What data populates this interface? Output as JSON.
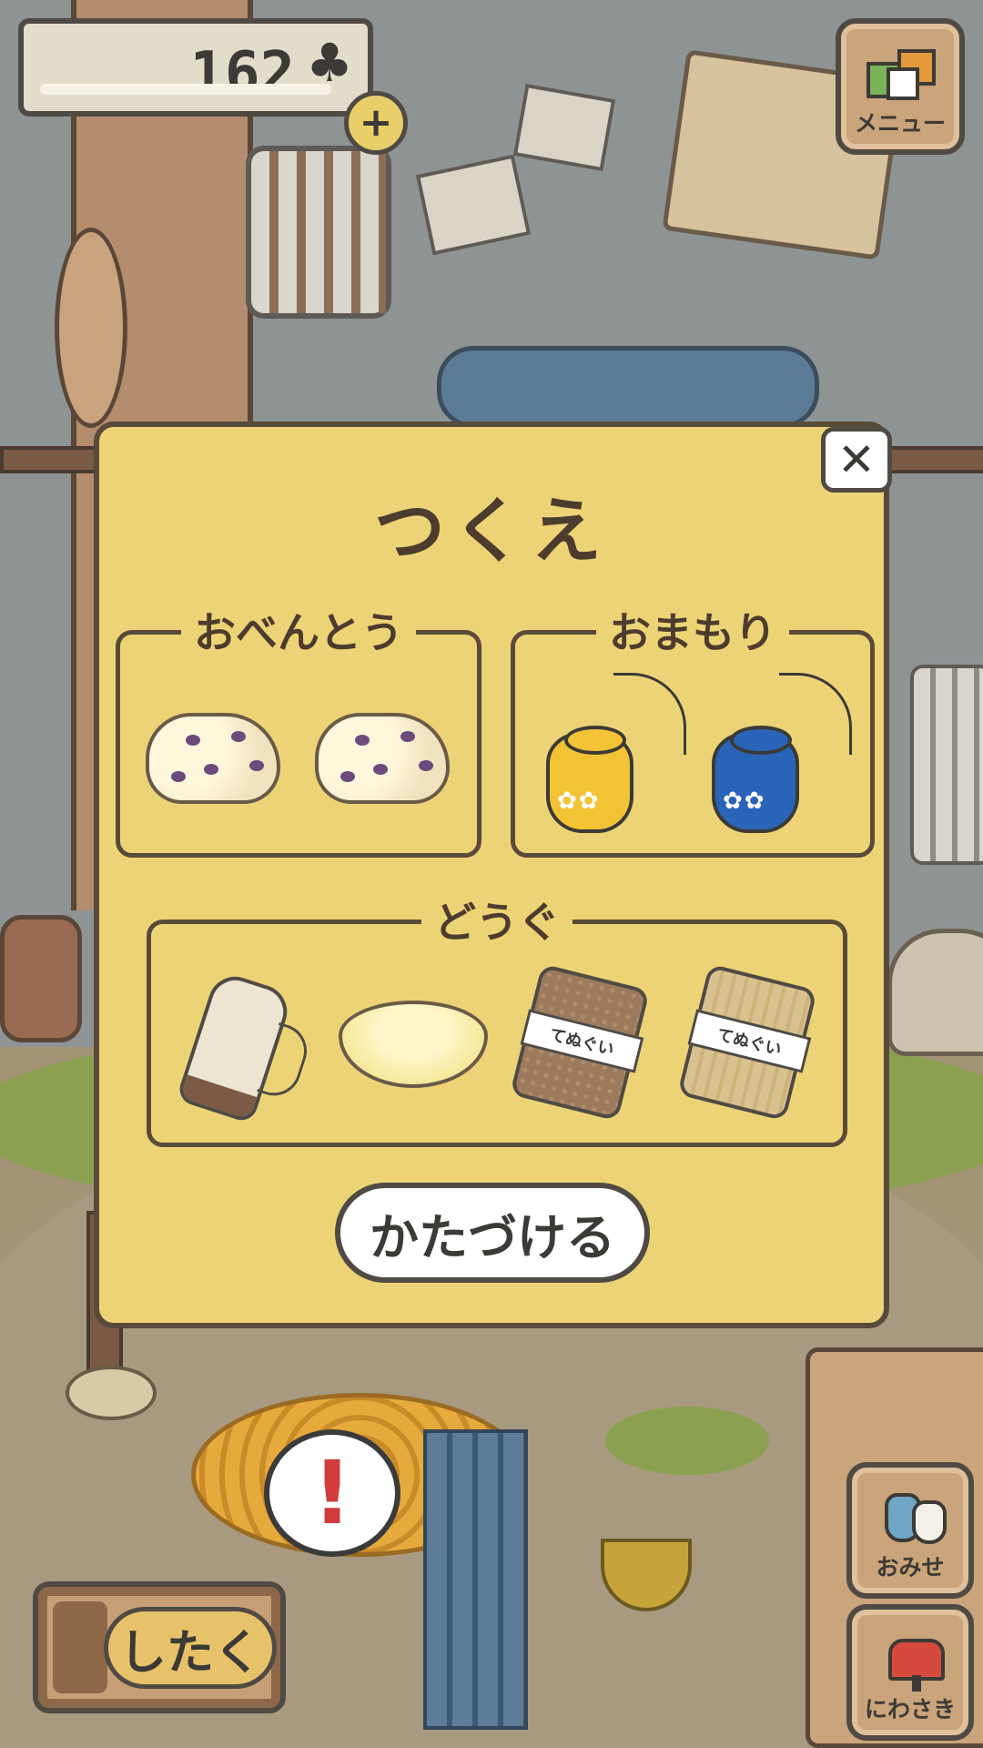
{
  "currency": {
    "value": "162",
    "icon": "clover-icon",
    "add_label": "+"
  },
  "menu_button": {
    "label": "メニュー",
    "icon": "menu-cards-icon"
  },
  "modal": {
    "title": "つくえ",
    "close_label": "✕",
    "groups": [
      {
        "title": "おべんとう",
        "items": [
          "bread-icon",
          "bread-icon"
        ]
      },
      {
        "title": "おまもり",
        "items": [
          "yellow-charm-icon",
          "blue-charm-icon"
        ]
      },
      {
        "title": "どうぐ",
        "items": [
          "flask-icon",
          "bowl-icon",
          "towel-icon",
          "towel-icon"
        ]
      }
    ],
    "towel_text": "てぬぐい",
    "tidy_label": "かたづける"
  },
  "prepare_button": {
    "label": "したく"
  },
  "side_buttons": [
    {
      "label": "おみせ",
      "icon": "shop-bags-icon"
    },
    {
      "label": "にわさき",
      "icon": "mailbox-icon"
    }
  ],
  "colors": {
    "modal_bg": "#ecd476",
    "border": "#5a4a3a",
    "charm_yellow": "#f2c335",
    "charm_blue": "#2a64b8",
    "notice_red": "#d23b3b"
  }
}
